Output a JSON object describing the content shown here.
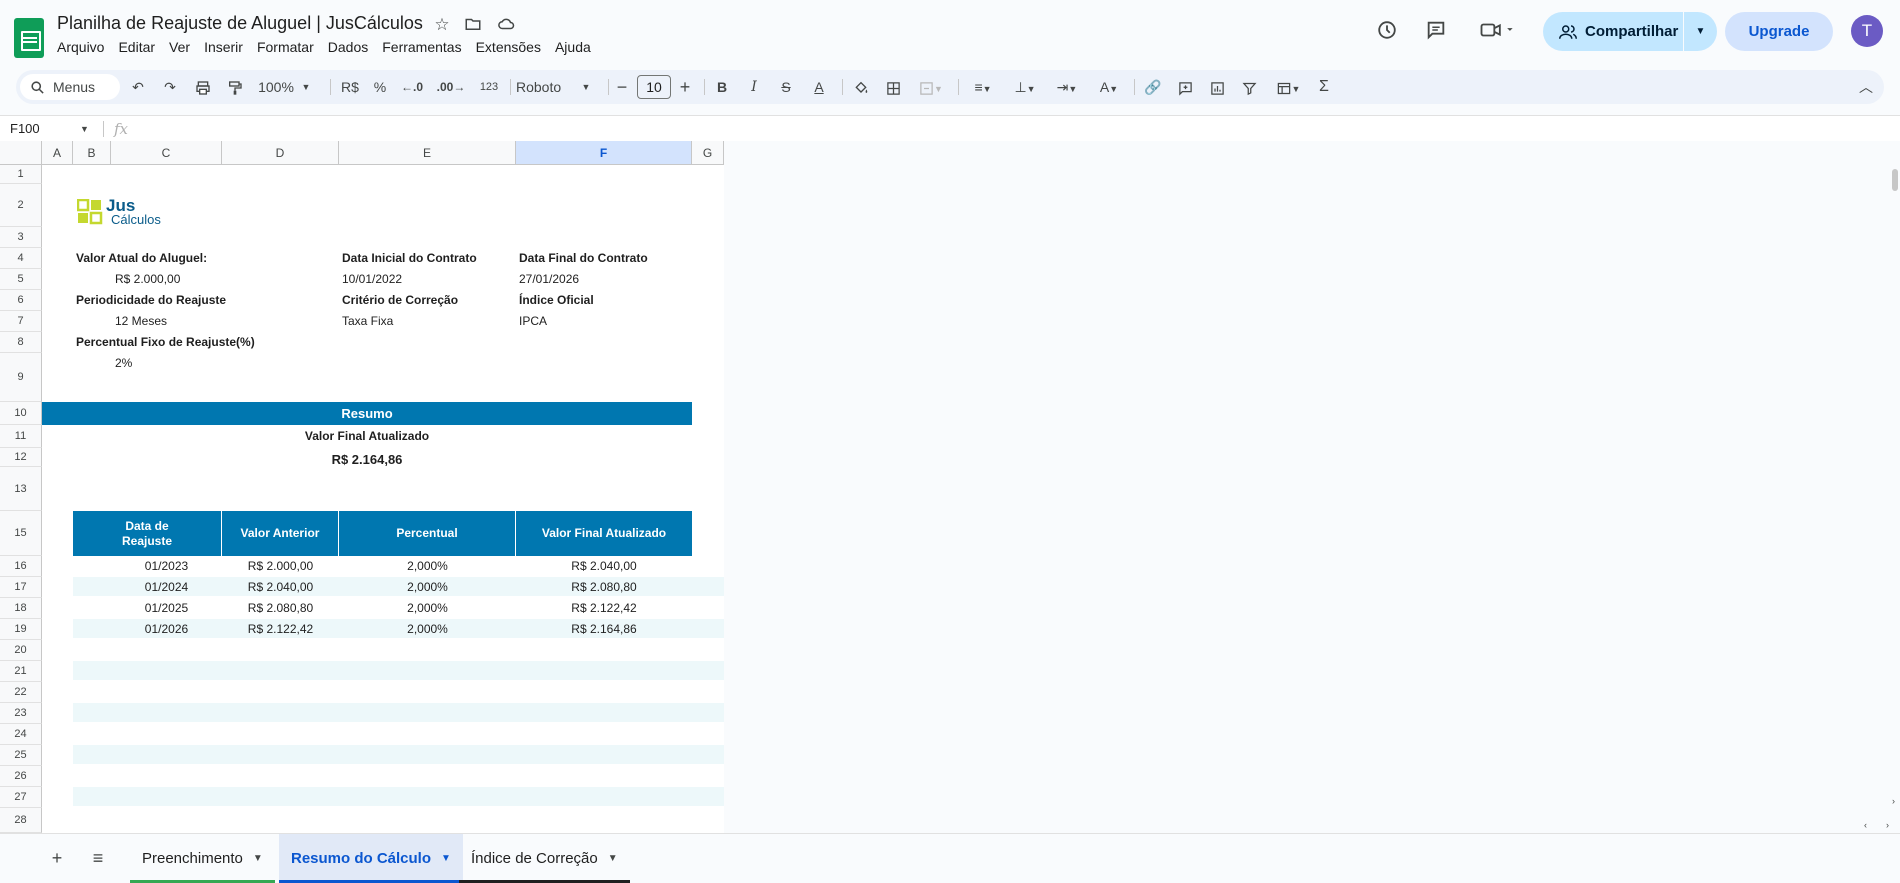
{
  "app": {
    "title": "Planilha de Reajuste de Aluguel | JusCálculos",
    "menus": [
      "Arquivo",
      "Editar",
      "Ver",
      "Inserir",
      "Formatar",
      "Dados",
      "Ferramentas",
      "Extensões",
      "Ajuda"
    ],
    "share_label": "Compartilhar",
    "upgrade_label": "Upgrade",
    "avatar_initial": "T"
  },
  "toolbar": {
    "search_label": "Menus",
    "zoom": "100%",
    "currency": "R$",
    "percent": "%",
    "decrease_decimal": ".0",
    "increase_decimal": ".00",
    "number_format": "123",
    "font_name": "Roboto",
    "font_size": "10"
  },
  "formula_bar": {
    "name_box": "F100",
    "fx": "fx",
    "content": ""
  },
  "grid": {
    "columns": [
      "A",
      "B",
      "C",
      "D",
      "E",
      "F",
      "G"
    ],
    "selected_column": "F",
    "rows": [
      "1",
      "2",
      "3",
      "4",
      "5",
      "6",
      "7",
      "8",
      "9",
      "10",
      "11",
      "12",
      "13",
      "15",
      "16",
      "17",
      "18",
      "19",
      "20",
      "21",
      "22",
      "23",
      "24",
      "25",
      "26",
      "27",
      "28"
    ]
  },
  "sheet": {
    "logo": {
      "line1": "Jus",
      "line2": "Cálculos"
    },
    "fields": {
      "valor_atual_label": "Valor Atual do Aluguel:",
      "valor_atual_value": "R$ 2.000,00",
      "data_inicial_label": "Data Inicial do Contrato",
      "data_inicial_value": "10/01/2022",
      "data_final_label": "Data Final do Contrato",
      "data_final_value": "27/01/2026",
      "periodicidade_label": "Periodicidade do Reajuste",
      "periodicidade_value": "12 Meses",
      "criterio_label": "Critério de Correção",
      "criterio_value": "Taxa Fixa",
      "indice_label": "Índice Oficial",
      "indice_value": "IPCA",
      "percentual_label": "Percentual Fixo de Reajuste(%)",
      "percentual_value": "2%"
    },
    "resumo": {
      "title": "Resumo",
      "valor_final_label": "Valor Final Atualizado",
      "valor_final_value": "R$ 2.164,86"
    },
    "table": {
      "headers": [
        "Data de Reajuste",
        "Valor  Anterior",
        "Percentual",
        "Valor Final Atualizado"
      ],
      "rows": [
        [
          "01/2023",
          "R$ 2.000,00",
          "2,000%",
          "R$ 2.040,00"
        ],
        [
          "01/2024",
          "R$ 2.040,00",
          "2,000%",
          "R$ 2.080,80"
        ],
        [
          "01/2025",
          "R$ 2.080,80",
          "2,000%",
          "R$ 2.122,42"
        ],
        [
          "01/2026",
          "R$ 2.122,42",
          "2,000%",
          "R$ 2.164,86"
        ]
      ]
    }
  },
  "tabs": [
    {
      "label": "Preenchimento",
      "active": false,
      "color": "#34a853"
    },
    {
      "label": "Resumo do Cálculo",
      "active": true,
      "color": "#0b57d0"
    },
    {
      "label": "Índice de Correção",
      "active": false,
      "color": "#1f1f1f"
    }
  ]
}
